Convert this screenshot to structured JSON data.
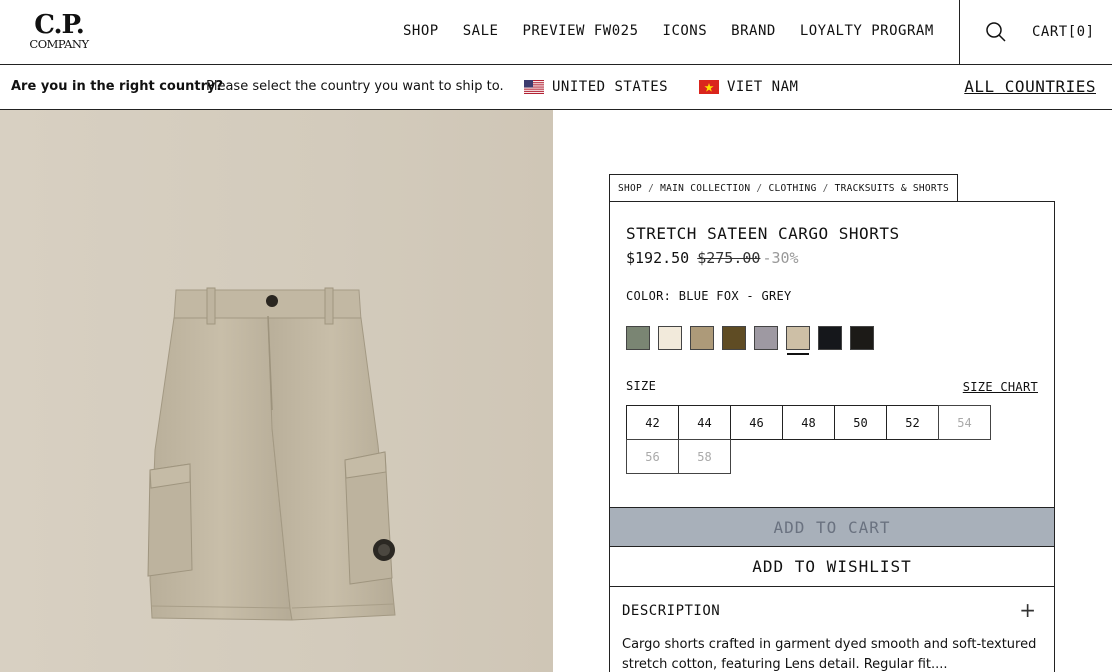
{
  "brand": {
    "logo_main": "C.P.",
    "logo_sub": "COMPANY"
  },
  "nav": {
    "items": [
      {
        "label": "SHOP"
      },
      {
        "label": "SALE"
      },
      {
        "label": "PREVIEW FW025"
      },
      {
        "label": "ICONS"
      },
      {
        "label": "BRAND"
      },
      {
        "label": "LOYALTY PROGRAM"
      }
    ],
    "cart_label": "CART[0]"
  },
  "country_bar": {
    "question": "Are you in the right country?",
    "prompt": "Please select the country you want to ship to.",
    "options": [
      {
        "label": "UNITED STATES",
        "flag": "us-flag-icon"
      },
      {
        "label": "VIET NAM",
        "flag": "vn-flag-icon"
      }
    ],
    "all_countries": "ALL COUNTRIES"
  },
  "breadcrumb": [
    "SHOP",
    "MAIN COLLECTION",
    "CLOTHING",
    "TRACKSUITS & SHORTS"
  ],
  "product": {
    "title": "STRETCH SATEEN CARGO SHORTS",
    "price_now": "$192.50",
    "price_old": "$275.00",
    "discount": "-30%",
    "color_label": "COLOR:",
    "color_value": "BLUE FOX - GREY",
    "swatches": [
      "#7a8573",
      "#f2eadb",
      "#ad9a79",
      "#5f4c24",
      "#9e99a2",
      "#cdbfa6",
      "#15171b",
      "#1c1a17"
    ],
    "selected_swatch": 5,
    "size_label": "SIZE",
    "size_chart": "SIZE CHART",
    "sizes": [
      {
        "label": "42",
        "available": true
      },
      {
        "label": "44",
        "available": true
      },
      {
        "label": "46",
        "available": true
      },
      {
        "label": "48",
        "available": true
      },
      {
        "label": "50",
        "available": true
      },
      {
        "label": "52",
        "available": true
      },
      {
        "label": "54",
        "available": false
      },
      {
        "label": "56",
        "available": false
      },
      {
        "label": "58",
        "available": false
      }
    ],
    "add_to_cart": "ADD TO CART",
    "add_to_wishlist": "ADD TO WISHLIST",
    "description_title": "DESCRIPTION",
    "description_text": "Cargo shorts crafted in garment dyed smooth and soft-textured stretch cotton, featuring Lens detail. Regular fit...."
  },
  "colors": {
    "add_to_cart_bg": "#a8b0ba",
    "image_bg": "#d3cbbc"
  }
}
